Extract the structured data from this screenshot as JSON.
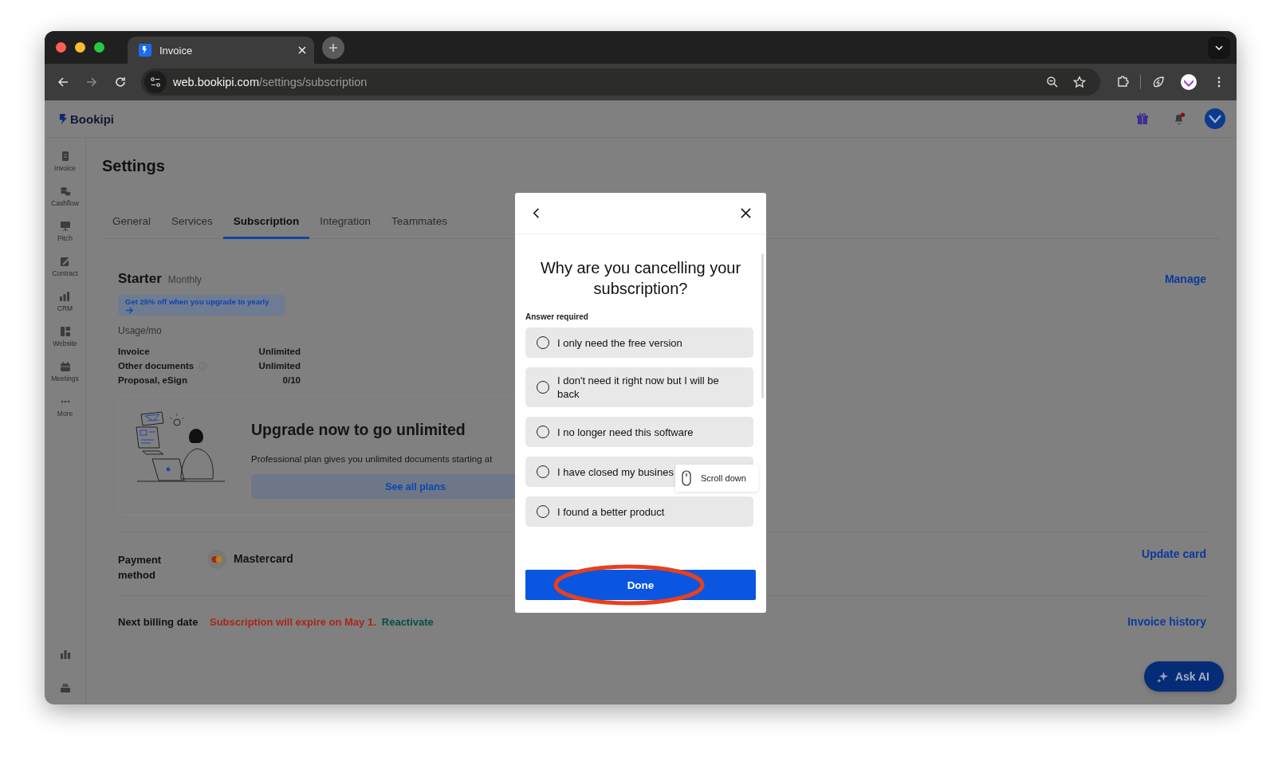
{
  "browser": {
    "tab": {
      "title": "Invoice"
    },
    "url": {
      "host": "web.bookipi.com",
      "path": "/settings/subscription"
    }
  },
  "app": {
    "logo": "Bookipi",
    "notifications": true
  },
  "sidebar": {
    "items": [
      {
        "label": "Invoice"
      },
      {
        "label": "Cashflow"
      },
      {
        "label": "Pitch"
      },
      {
        "label": "Contract"
      },
      {
        "label": "CRM"
      },
      {
        "label": "Website"
      },
      {
        "label": "Meetings"
      },
      {
        "label": "More"
      }
    ]
  },
  "page": {
    "title": "Settings"
  },
  "tabs": [
    {
      "label": "General",
      "selected": false
    },
    {
      "label": "Services",
      "selected": false
    },
    {
      "label": "Subscription",
      "selected": true
    },
    {
      "label": "Integration",
      "selected": false
    },
    {
      "label": "Teammates",
      "selected": false
    }
  ],
  "plan": {
    "name": "Starter",
    "period": "Monthly",
    "promo": "Get 25% off when you upgrade to yearly",
    "manage": "Manage"
  },
  "usage": {
    "heading": "Usage/mo",
    "rows": [
      {
        "label": "Invoice",
        "value": "Unlimited",
        "info": false
      },
      {
        "label": "Other documents",
        "value": "Unlimited",
        "info": true
      },
      {
        "label": "Proposal, eSign",
        "value": "0/10",
        "info": false
      }
    ]
  },
  "upgrade": {
    "title": "Upgrade now to go unlimited",
    "description": "Professional plan gives you unlimited documents starting at",
    "button": "See all plans"
  },
  "payment": {
    "label": "Payment method",
    "card": "Mastercard",
    "action": "Update card"
  },
  "billing": {
    "label": "Next billing date",
    "notice": "Subscription will expire on May 1.",
    "link": "Reactivate",
    "action": "Invoice history"
  },
  "ask_ai": {
    "label": "Ask AI"
  },
  "modal": {
    "title": "Why are you cancelling your subscription?",
    "hint": "Answer required",
    "options": [
      {
        "label": "I only need the free version",
        "selected": false
      },
      {
        "label": "I don't need it right now but I will be back",
        "selected": false
      },
      {
        "label": "I no longer need this software",
        "selected": false
      },
      {
        "label": "I have closed my busines",
        "selected": false
      },
      {
        "label": "I found a better product",
        "selected": false
      }
    ],
    "tooltip": "Scroll down",
    "button": "Done",
    "button_highlighted": true
  }
}
